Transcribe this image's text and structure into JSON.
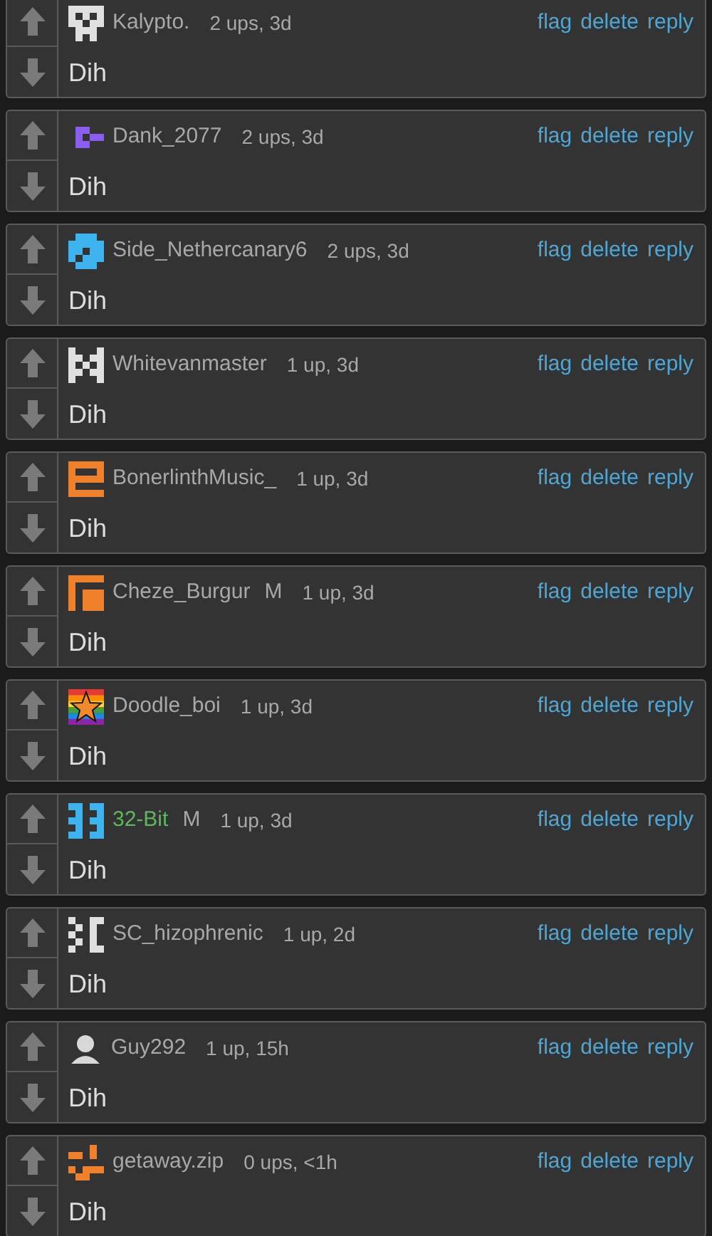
{
  "comments": [
    {
      "user": "Kalypto.",
      "meta": "2 ups, 3d",
      "color": "#e0e0e0",
      "kind": "identicon",
      "highlighted": false,
      "body": "Dih",
      "actions": [
        "flag",
        "delete",
        "reply"
      ]
    },
    {
      "user": "Dank_2077",
      "meta": "2 ups, 3d",
      "color": "#8a5cf0",
      "kind": "identicon",
      "highlighted": false,
      "body": "Dih",
      "actions": [
        "flag",
        "delete",
        "reply"
      ]
    },
    {
      "user": "Side_Nethercanary6",
      "meta": "2 ups, 3d",
      "color": "#3db4f0",
      "kind": "identicon",
      "highlighted": false,
      "body": "Dih",
      "actions": [
        "flag",
        "delete",
        "reply"
      ]
    },
    {
      "user": "Whitevanmaster",
      "meta": "1 up, 3d",
      "color": "#e0e0e0",
      "kind": "identicon",
      "highlighted": false,
      "body": "Dih",
      "actions": [
        "flag",
        "delete",
        "reply"
      ]
    },
    {
      "user": "BonerlinthMusic_",
      "meta": "1 up, 3d",
      "color": "#f0802a",
      "kind": "identicon",
      "highlighted": false,
      "body": "Dih",
      "actions": [
        "flag",
        "delete",
        "reply"
      ]
    },
    {
      "user": "Cheze_Burgur",
      "badge": "M",
      "meta": "1 up, 3d",
      "color": "#f0802a",
      "kind": "identicon",
      "highlighted": false,
      "body": "Dih",
      "actions": [
        "flag",
        "delete",
        "reply"
      ]
    },
    {
      "user": "Doodle_boi",
      "meta": "1 up, 3d",
      "color": "#f08a2a",
      "kind": "star",
      "highlighted": false,
      "body": "Dih",
      "actions": [
        "flag",
        "delete",
        "reply"
      ]
    },
    {
      "user": "32-Bit",
      "badge": "M",
      "meta": "1 up, 3d",
      "color": "#3db4f0",
      "kind": "identicon",
      "highlighted": true,
      "body": "Dih",
      "actions": [
        "flag",
        "delete",
        "reply"
      ]
    },
    {
      "user": "SC_hizophrenic",
      "meta": "1 up, 2d",
      "color": "#e0e0e0",
      "kind": "identicon",
      "highlighted": false,
      "body": "Dih",
      "actions": [
        "flag",
        "delete",
        "reply"
      ]
    },
    {
      "user": "Guy292",
      "meta": "1 up, 15h",
      "color": "#d8d8d8",
      "kind": "person",
      "highlighted": false,
      "body": "Dih",
      "actions": [
        "flag",
        "delete",
        "reply"
      ]
    },
    {
      "user": "getaway.zip",
      "meta": "0 ups, <1h",
      "color": "#f0802a",
      "kind": "identicon",
      "highlighted": false,
      "body": "Dih",
      "actions": [
        "flag",
        "delete",
        "reply"
      ]
    }
  ]
}
